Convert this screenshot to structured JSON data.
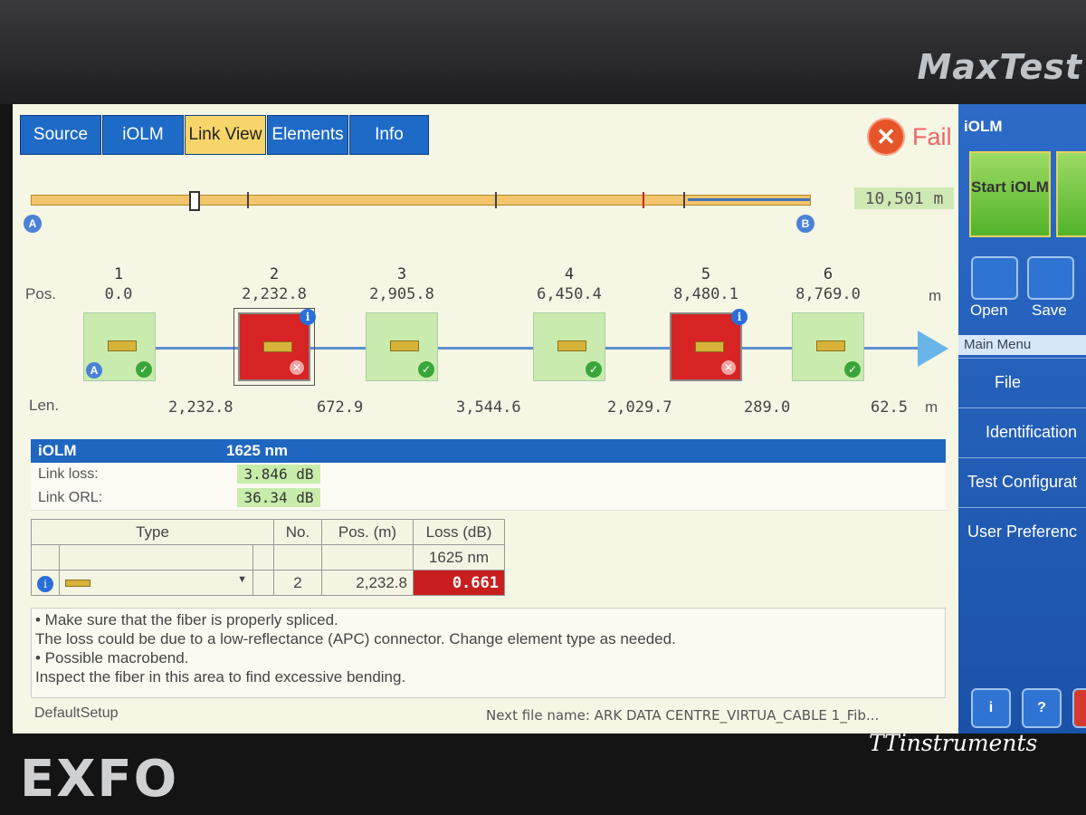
{
  "device": {
    "brand": "MaxTest",
    "maker": "EXFO",
    "watermark": "TTinstruments"
  },
  "tabs": [
    "Source",
    "iOLM",
    "Link View",
    "Elements",
    "Info"
  ],
  "active_tab": "Link View",
  "status": {
    "result": "Fail"
  },
  "overview": {
    "total_length": "10,501 m",
    "start_label": "A",
    "end_label": "B"
  },
  "link": {
    "pos_label": "Pos.",
    "len_label": "Len.",
    "unit": "m",
    "elements": [
      {
        "no": "1",
        "pos": "0.0",
        "status": "pass"
      },
      {
        "no": "2",
        "pos": "2,232.8",
        "status": "fail"
      },
      {
        "no": "3",
        "pos": "2,905.8",
        "status": "pass"
      },
      {
        "no": "4",
        "pos": "6,450.4",
        "status": "pass"
      },
      {
        "no": "5",
        "pos": "8,480.1",
        "status": "fail"
      },
      {
        "no": "6",
        "pos": "8,769.0",
        "status": "pass"
      }
    ],
    "lengths": [
      "2,232.8",
      "672.9",
      "3,544.6",
      "2,029.7",
      "289.0",
      "62.5"
    ]
  },
  "summary": {
    "title": "iOLM",
    "wavelength": "1625 nm",
    "link_loss_label": "Link loss:",
    "link_loss": "3.846 dB",
    "link_orl_label": "Link ORL:",
    "link_orl": "36.34 dB"
  },
  "element_table": {
    "headers": {
      "type": "Type",
      "no": "No.",
      "pos": "Pos. (m)",
      "loss": "Loss (dB)",
      "wavelength": "1625 nm"
    },
    "row": {
      "no": "2",
      "pos": "2,232.8",
      "loss": "0.661"
    }
  },
  "messages": [
    "• Make sure that the fiber is properly spliced.",
    "The loss could be due to a low-reflectance (APC) connector. Change element type as needed.",
    "• Possible macrobend.",
    "Inspect the fiber in this area to find excessive bending."
  ],
  "footer": {
    "setup": "DefaultSetup",
    "next_file": "Next file name: ARK DATA CENTRE_VIRTUA_CABLE 1_Fib..."
  },
  "sidebar": {
    "title": "iOLM",
    "start_button": "Start iOLM",
    "open_label": "Open",
    "save_label": "Save",
    "main_menu": "Main Menu",
    "menu_items": [
      "File",
      "Identification",
      "Test Configurat",
      "User Preferenc"
    ]
  }
}
